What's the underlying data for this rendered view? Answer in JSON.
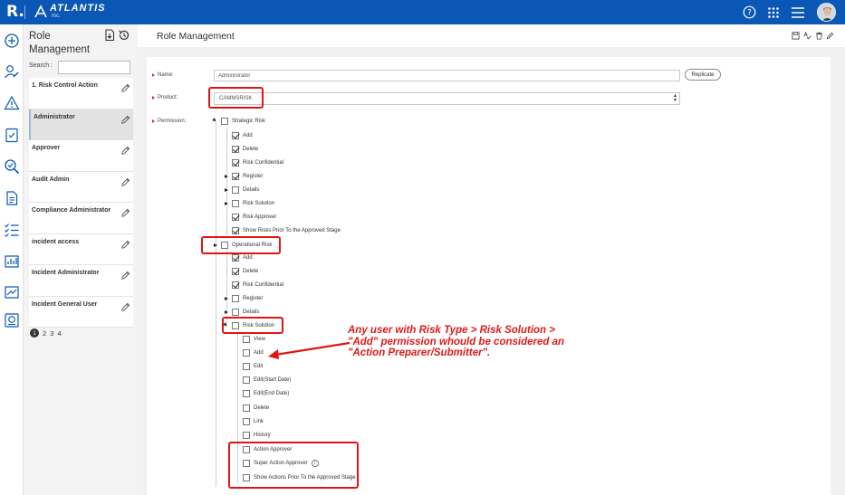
{
  "topbar": {
    "brand_letter": "R.",
    "brand_name": "ATLANTIS",
    "brand_sub": "Inc.",
    "colors": {
      "bar": "#0b57b5",
      "highlight": "#e01414"
    },
    "icons": [
      "help-icon",
      "apps-grid-icon",
      "hamburger-menu-icon",
      "user-avatar"
    ]
  },
  "rail": {
    "icons": [
      "add-circle-icon",
      "user-edit-icon",
      "warning-icon",
      "clipboard-check-icon",
      "search-check-icon",
      "document-icon",
      "checklist-icon",
      "report-chart-icon",
      "trend-chart-icon",
      "dashboard-icon"
    ]
  },
  "list_panel": {
    "title": "Role Management",
    "search_label": "Search :",
    "search_value": "",
    "items": [
      {
        "label": "1. Risk Control Action"
      },
      {
        "label": "Administrator"
      },
      {
        "label": "Approver"
      },
      {
        "label": "Audit Admin"
      },
      {
        "label": "Compliance Administrator"
      },
      {
        "label": "incident access"
      },
      {
        "label": "Incident Administrator"
      },
      {
        "label": "Incident General User"
      }
    ],
    "pages": [
      "1",
      "2",
      "3",
      "4"
    ],
    "current_page": "1"
  },
  "main": {
    "title": "Role Management",
    "name_label": "Name:",
    "name_value": "Administrator",
    "replicate_label": "Replicate",
    "product_label": "Product:",
    "product_value": "CAMMSRISK",
    "permission_label": "Permission:"
  },
  "tree": [
    {
      "label": "Strategic Risk",
      "checked": false
    },
    {
      "label": "Add",
      "checked": true
    },
    {
      "label": "Delete",
      "checked": true
    },
    {
      "label": "Risk Confidential",
      "checked": true
    },
    {
      "label": "Register",
      "checked": true
    },
    {
      "label": "Details",
      "checked": false
    },
    {
      "label": "Risk Solution",
      "checked": false
    },
    {
      "label": "Risk Approver",
      "checked": true
    },
    {
      "label": "Show Risks Prior To the Approved Stage",
      "checked": true
    },
    {
      "label": "Operational Risk",
      "checked": false
    },
    {
      "label": "Add",
      "checked": true
    },
    {
      "label": "Delete",
      "checked": true
    },
    {
      "label": "Risk Confidential",
      "checked": true
    },
    {
      "label": "Register",
      "checked": false
    },
    {
      "label": "Details",
      "checked": false
    },
    {
      "label": "Risk Solution",
      "checked": false
    },
    {
      "label": "View",
      "checked": false
    },
    {
      "label": "Add",
      "checked": false
    },
    {
      "label": "Edit",
      "checked": false
    },
    {
      "label": "Edit(Start Date)",
      "checked": false
    },
    {
      "label": "Edit(End Date)",
      "checked": false
    },
    {
      "label": "Delete",
      "checked": false
    },
    {
      "label": "Link",
      "checked": false
    },
    {
      "label": "History",
      "checked": false
    },
    {
      "label": "Action Approver",
      "checked": false
    },
    {
      "label": "Super Action Approver",
      "checked": false
    },
    {
      "label": "Show Actions Prior To the Approved Stage",
      "checked": false
    }
  ],
  "annotation": {
    "text": "Any user with Risk Type > Risk Solution > \"Add\" permission whould be considered an \"Action Preparer/Submitter\"."
  }
}
